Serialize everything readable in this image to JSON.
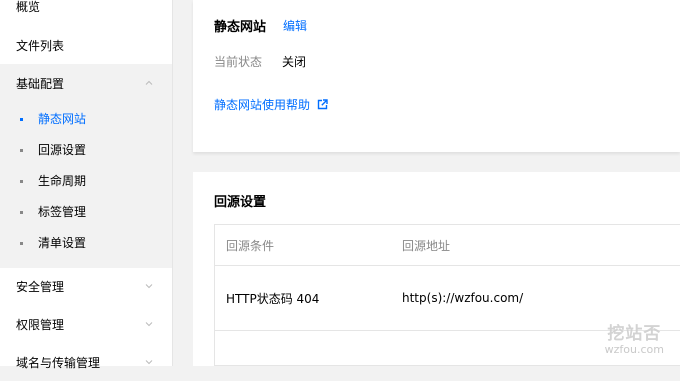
{
  "sidebar": {
    "items_top": [
      {
        "label": "概览"
      },
      {
        "label": "文件列表"
      }
    ],
    "group": {
      "label": "基础配置",
      "children": [
        {
          "label": "静态网站",
          "active": true
        },
        {
          "label": "回源设置"
        },
        {
          "label": "生命周期"
        },
        {
          "label": "标签管理"
        },
        {
          "label": "清单设置"
        }
      ]
    },
    "items_bottom": [
      {
        "label": "安全管理"
      },
      {
        "label": "权限管理"
      },
      {
        "label": "域名与传输管理"
      }
    ]
  },
  "static_site": {
    "title": "静态网站",
    "edit_label": "编辑",
    "status_label": "当前状态",
    "status_value": "关闭",
    "help_link": "静态网站使用帮助"
  },
  "origin": {
    "title": "回源设置",
    "columns": [
      "回源条件",
      "回源地址"
    ],
    "rows": [
      [
        "HTTP状态码 404",
        "http(s)://wzfou.com/"
      ]
    ]
  },
  "watermark": {
    "logo": "挖站否",
    "domain": "wzfou.com"
  },
  "colors": {
    "accent": "#006eff",
    "sidebar_group_bg": "#f2f2f2"
  }
}
